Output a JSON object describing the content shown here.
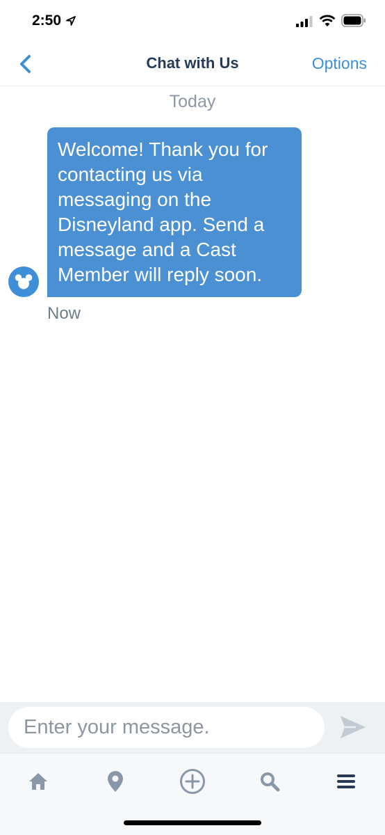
{
  "status_bar": {
    "time": "2:50"
  },
  "nav": {
    "title": "Chat with Us",
    "options_label": "Options"
  },
  "chat": {
    "date_divider": "Today",
    "messages": [
      {
        "text": "Welcome! Thank you for contacting us via messaging on the Disneyland app. Send a message and a Cast Member will reply soon.",
        "time": "Now"
      }
    ]
  },
  "composer": {
    "placeholder": "Enter your message."
  },
  "tab_bar": {
    "items": [
      "home-icon",
      "map-pin-icon",
      "plus-circle-icon",
      "search-icon",
      "menu-icon"
    ]
  },
  "colors": {
    "accent": "#3b8fd9",
    "bubble": "#4a90d3",
    "title": "#253b56",
    "tab_icon": "#8a97a8",
    "menu_icon": "#253b56"
  }
}
